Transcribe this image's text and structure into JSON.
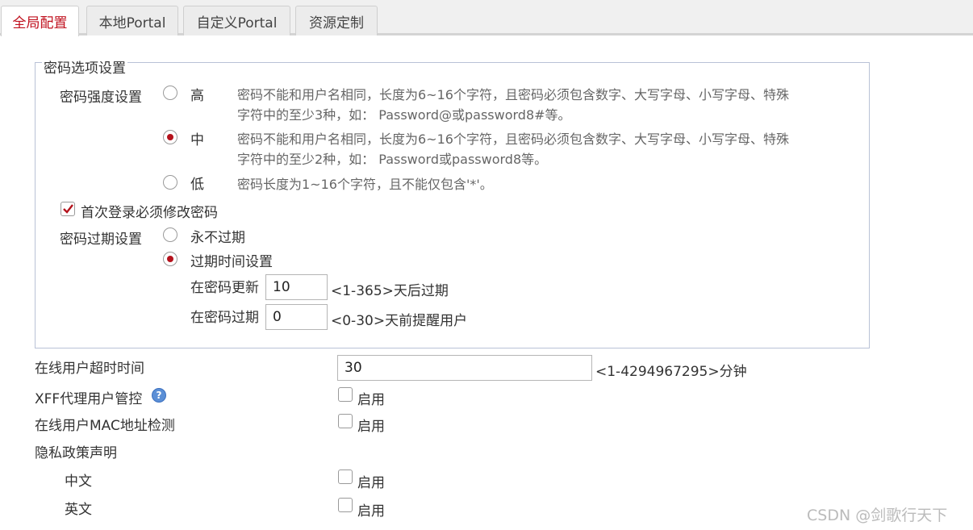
{
  "tabs": [
    "全局配置",
    "本地Portal",
    "自定义Portal",
    "资源定制"
  ],
  "password_options": {
    "legend": "密码选项设置",
    "strength_label": "密码强度设置",
    "strength_levels": [
      {
        "label": "高",
        "desc": "密码不能和用户名相同，长度为6~16个字符，且密码必须包含数字、大写字母、小写字母、特殊字符中的至少3种，如： Password@或password8#等。",
        "selected": false
      },
      {
        "label": "中",
        "desc": "密码不能和用户名相同，长度为6~16个字符，且密码必须包含数字、大写字母、小写字母、特殊字符中的至少2种，如： Password或password8等。",
        "selected": true
      },
      {
        "label": "低",
        "desc": "密码长度为1~16个字符，且不能仅包含'*'。",
        "selected": false
      }
    ],
    "first_login_change": {
      "label": "首次登录必须修改密码",
      "checked": true
    },
    "expiry_label": "密码过期设置",
    "expiry_options": [
      {
        "label": "永不过期",
        "selected": false
      },
      {
        "label": "过期时间设置",
        "selected": true
      }
    ],
    "update_label": "在密码更新",
    "update_value": "10",
    "update_hint": "<1-365>天后过期",
    "remind_label": "在密码过期",
    "remind_value": "0",
    "remind_hint": "<0-30>天前提醒用户"
  },
  "timeout": {
    "label": "在线用户超时时间",
    "value": "30",
    "hint": "<1-4294967295>分钟"
  },
  "xff": {
    "label": "XFF代理用户管控",
    "help_glyph": "?",
    "enable_label": "启用",
    "checked": false
  },
  "mac_check": {
    "label": "在线用户MAC地址检测",
    "enable_label": "启用",
    "checked": false
  },
  "privacy": {
    "label": "隐私政策声明",
    "chinese": {
      "label": "中文",
      "enable_label": "启用",
      "checked": false
    },
    "english": {
      "label": "英文",
      "enable_label": "启用",
      "checked": false
    }
  },
  "watermark": "CSDN @剑歌行天下",
  "colors": {
    "accent": "#c0121f",
    "radio_dot": "#b4121c",
    "fieldset_border": "#b9c2d6"
  }
}
